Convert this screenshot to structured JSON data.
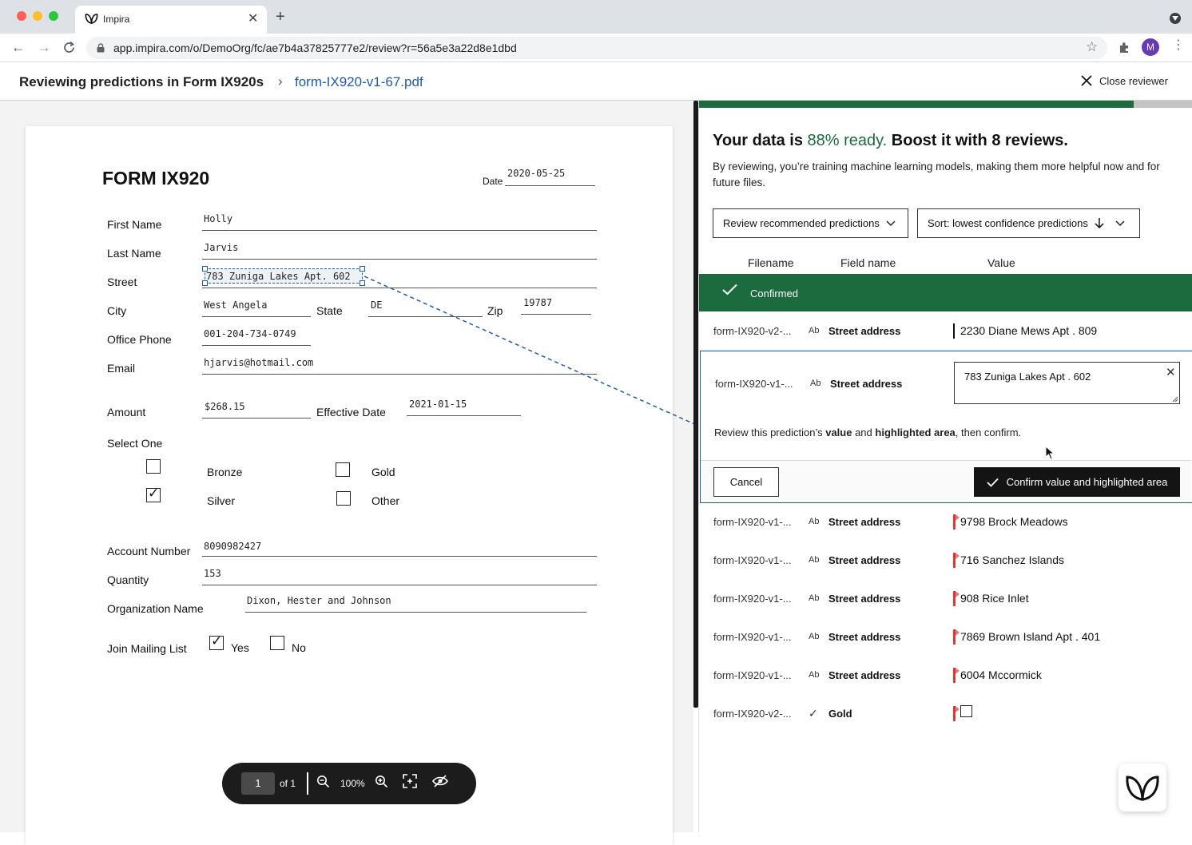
{
  "browser": {
    "tab_title": "Impira",
    "url": "app.impira.com/o/DemoOrg/fc/ae7b4a37825777e2/review?r=56a5e3a22d8e1dbd",
    "avatar_initial": "M"
  },
  "header": {
    "breadcrumb_root": "Reviewing predictions in Form IX920s",
    "breadcrumb_file": "form-IX920-v1-67.pdf",
    "close_label": "Close reviewer"
  },
  "document": {
    "title": "FORM IX920",
    "date_label": "Date",
    "date_value": "2020-05-25",
    "fields": {
      "first_name": {
        "label": "First Name",
        "value": "Holly"
      },
      "last_name": {
        "label": "Last Name",
        "value": "Jarvis"
      },
      "street": {
        "label": "Street",
        "value": "783 Zuniga Lakes Apt. 602"
      },
      "city": {
        "label": "City",
        "value": "West Angela"
      },
      "state": {
        "label": "State",
        "value": "DE"
      },
      "zip": {
        "label": "Zip",
        "value": "19787"
      },
      "office_phone": {
        "label": "Office Phone",
        "value": "001-204-734-0749"
      },
      "email": {
        "label": "Email",
        "value": "hjarvis@hotmail.com"
      },
      "amount": {
        "label": "Amount",
        "value": "$268.15"
      },
      "effective_date": {
        "label": "Effective Date",
        "value": "2021-01-15"
      },
      "account_number": {
        "label": "Account Number",
        "value": "8090982427"
      },
      "quantity": {
        "label": "Quantity",
        "value": "153"
      },
      "organization_name": {
        "label": "Organization Name",
        "value": "Dixon, Hester and Johnson"
      }
    },
    "select_one": {
      "label": "Select One",
      "options": [
        {
          "label": "Bronze",
          "checked": false
        },
        {
          "label": "Gold",
          "checked": false
        },
        {
          "label": "Silver",
          "checked": true
        },
        {
          "label": "Other",
          "checked": false
        }
      ]
    },
    "mailing_list": {
      "label": "Join Mailing List",
      "yes_label": "Yes",
      "yes_checked": true,
      "no_label": "No",
      "no_checked": false
    }
  },
  "pager": {
    "page": "1",
    "of_label": "of 1",
    "zoom": "100%"
  },
  "panel": {
    "progress_fraction": 0.88,
    "heading_pre": "Your data is ",
    "heading_pct": "88% ready.",
    "heading_post": " Boost it with 8 reviews.",
    "description": "By reviewing, you’re training machine learning models, making them more helpful now and for future files.",
    "filter_dropdown": "Review recommended predictions",
    "sort_dropdown": "Sort: lowest confidence predictions",
    "columns": {
      "filename": "Filename",
      "field": "Field name",
      "value": "Value"
    },
    "confirmed_label": "Confirmed",
    "confirmed_row": {
      "filename": "form-IX920-v2-...",
      "type": "Ab",
      "field": "Street address",
      "value": "2230 Diane Mews Apt . 809"
    },
    "active_row": {
      "filename": "form-IX920-v1-...",
      "type": "Ab",
      "field": "Street address",
      "value": "783 Zuniga Lakes Apt . 602",
      "hint_1": "Review this prediction’s ",
      "hint_b1": "value",
      "hint_2": " and ",
      "hint_b2": "highlighted area",
      "hint_3": ", then confirm.",
      "cancel_label": "Cancel",
      "confirm_label": "Confirm value and highlighted area"
    },
    "rows": [
      {
        "filename": "form-IX920-v1-...",
        "type": "Ab",
        "field": "Street address",
        "value": "9798 Brock Meadows"
      },
      {
        "filename": "form-IX920-v1-...",
        "type": "Ab",
        "field": "Street address",
        "value": "716 Sanchez Islands"
      },
      {
        "filename": "form-IX920-v1-...",
        "type": "Ab",
        "field": "Street address",
        "value": "908 Rice Inlet"
      },
      {
        "filename": "form-IX920-v1-...",
        "type": "Ab",
        "field": "Street address",
        "value": "7869 Brown Island Apt . 401"
      },
      {
        "filename": "form-IX920-v1-...",
        "type": "Ab",
        "field": "Street address",
        "value": "6004 Mccormick"
      }
    ],
    "gold_row": {
      "filename": "form-IX920-v2-...",
      "type": "✓",
      "field": "Gold"
    }
  },
  "colors": {
    "brand_green": "#1c6b3f",
    "link_blue": "#1f5ca8",
    "flag_red": "#d93a3a"
  }
}
